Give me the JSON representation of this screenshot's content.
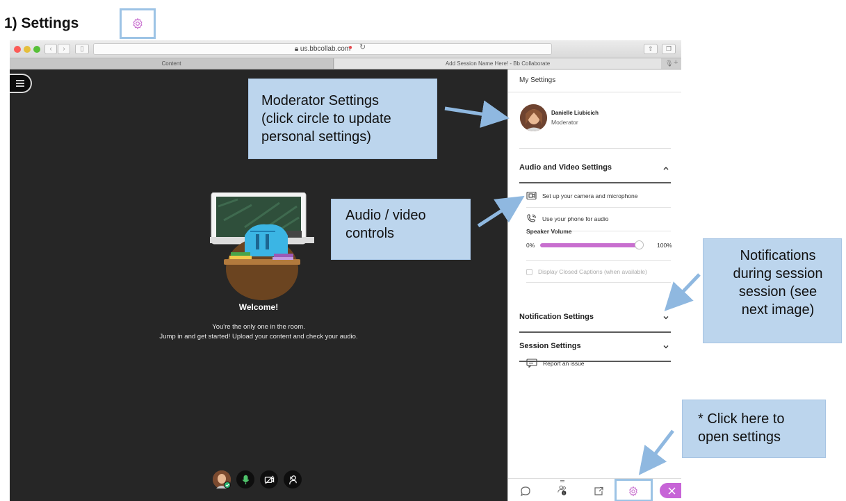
{
  "doc": {
    "heading": "1) Settings",
    "heading_icon": "gear-icon"
  },
  "browser": {
    "url": "us.bbcollab.com",
    "tabs": [
      "Content",
      "Add Session Name Here! - Bb Collaborate"
    ],
    "tab_plus": "+"
  },
  "stage": {
    "welcome_title": "Welcome!",
    "welcome_line1": "You're the only one in the room.",
    "welcome_line2": "Jump in and get started! Upload your content and check your audio.",
    "controls": [
      "avatar",
      "microphone-icon",
      "camera-off-icon",
      "raise-hand-icon"
    ]
  },
  "panel": {
    "title": "My Settings",
    "profile": {
      "name": "Danielle Liubicich",
      "role": "Moderator"
    },
    "audio_video": {
      "heading": "Audio and Video Settings",
      "expanded": true,
      "setup_label": "Set up your camera and microphone",
      "phone_label": "Use your phone for audio",
      "volume_label": "Speaker Volume",
      "volume_min": "0%",
      "volume_max": "100%",
      "volume_level": 1.0,
      "captions_label": "Display Closed Captions (when available)"
    },
    "notification_heading": "Notification Settings",
    "session_heading": "Session Settings",
    "report_label": "Report an issue",
    "bottom_bar": [
      "chat-icon",
      "attendees-icon",
      "share-icon",
      "gear-icon",
      "leave-icon"
    ],
    "attendee_count": "1"
  },
  "callouts": {
    "moderator": [
      "Moderator Settings",
      "(click circle to update",
      "personal settings)"
    ],
    "audio_video": [
      "Audio / video",
      "controls"
    ],
    "notifications": [
      "Notifications",
      "during session",
      "session (see",
      "next image)"
    ],
    "open_settings": [
      "* Click here to",
      "open settings"
    ]
  },
  "colors": {
    "accent_purple": "#c86fcf",
    "callout_blue": "#bcd5ed",
    "arrow_blue": "#8fb8e0",
    "stage_dark": "#262626"
  }
}
